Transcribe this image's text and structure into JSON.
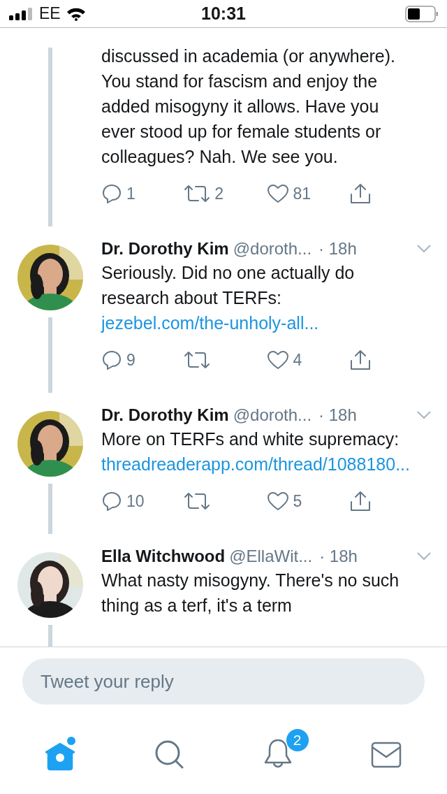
{
  "status_bar": {
    "carrier": "EE",
    "time": "10:31"
  },
  "tweets": [
    {
      "kind": "continued",
      "body": [
        {
          "text": "discussed in academia (or anywhere). You stand for fascism and enjoy the added misogyny it allows. Have you ever stood up for female students or colleagues? Nah. We see you."
        }
      ],
      "actions": {
        "replies": "1",
        "retweets": "2",
        "likes": "81"
      }
    },
    {
      "kind": "full",
      "avatar": {
        "kind": "picture"
      },
      "name": "Dr. Dorothy Kim",
      "handle": "@doroth...",
      "time": "· 18h",
      "body": [
        {
          "text": "Seriously. Did no one actually do research about TERFs: "
        },
        {
          "link": "jezebel.com/the-unholy-all..."
        }
      ],
      "actions": {
        "replies": "9",
        "likes": "4"
      }
    },
    {
      "kind": "full",
      "avatar": {
        "kind": "picture"
      },
      "name": "Dr. Dorothy Kim",
      "handle": "@doroth...",
      "time": "· 18h",
      "body": [
        {
          "text": "More on TERFs and white supremacy: "
        },
        {
          "link": "threadreaderapp.com/thread/1088180..."
        }
      ],
      "actions": {
        "replies": "10",
        "likes": "5"
      }
    },
    {
      "kind": "full",
      "avatar": {
        "kind": "picture"
      },
      "name": "Ella Witchwood",
      "handle": "@EllaWit...",
      "time": "· 18h",
      "body": [
        {
          "text": "What nasty misogyny. There's no such thing as a terf, it's a term"
        }
      ]
    }
  ],
  "reply": {
    "placeholder": "Tweet your reply"
  },
  "tabs": [
    {
      "kind": "home",
      "selected": true,
      "dot": true
    },
    {
      "kind": "search",
      "selected": false
    },
    {
      "kind": "notifications",
      "selected": false,
      "badge": "2"
    },
    {
      "kind": "messages",
      "selected": false
    }
  ]
}
